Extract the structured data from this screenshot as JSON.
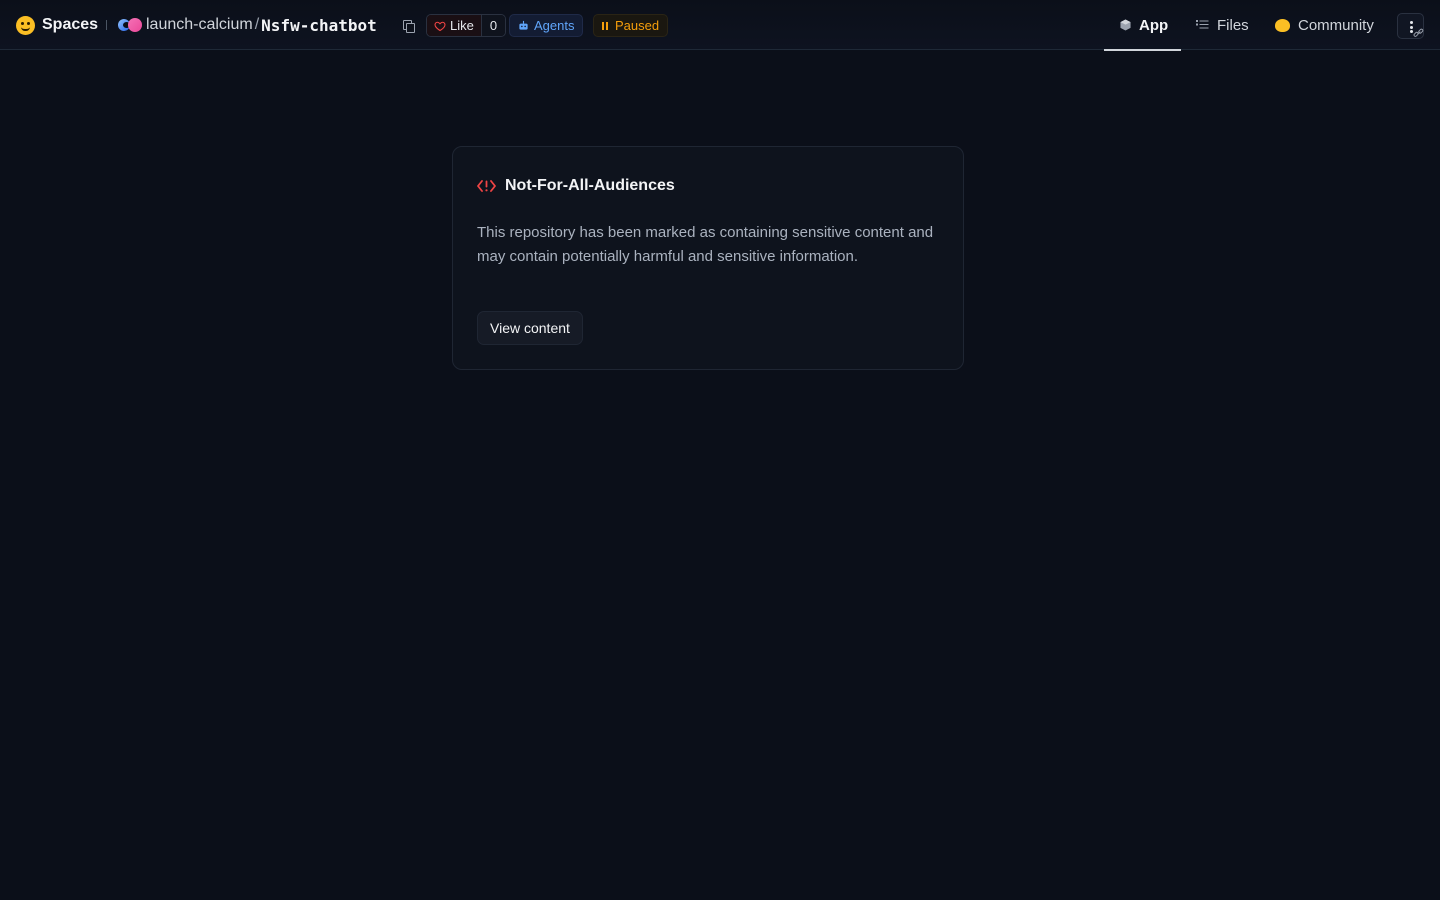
{
  "header": {
    "brand_label": "Spaces",
    "owner": "launch-calcium",
    "separator": "/",
    "repo_name": "Nsfw-chatbot",
    "like_label": "Like",
    "like_count": "0",
    "agents_label": "Agents",
    "status_label": "Paused"
  },
  "nav": {
    "tabs": [
      {
        "label": "App",
        "icon": "cube-icon",
        "active": true
      },
      {
        "label": "Files",
        "icon": "files-icon",
        "active": false
      },
      {
        "label": "Community",
        "icon": "community-icon",
        "active": false
      }
    ]
  },
  "warning_card": {
    "title": "Not-For-All-Audiences",
    "description": "This repository has been marked as containing sensitive content and may contain potentially harmful and sensitive information.",
    "button_label": "View content"
  },
  "colors": {
    "background": "#0b0f19",
    "warning_accent": "#ef4444",
    "agents_accent": "#60a5fa",
    "paused_accent": "#f59e0b"
  }
}
